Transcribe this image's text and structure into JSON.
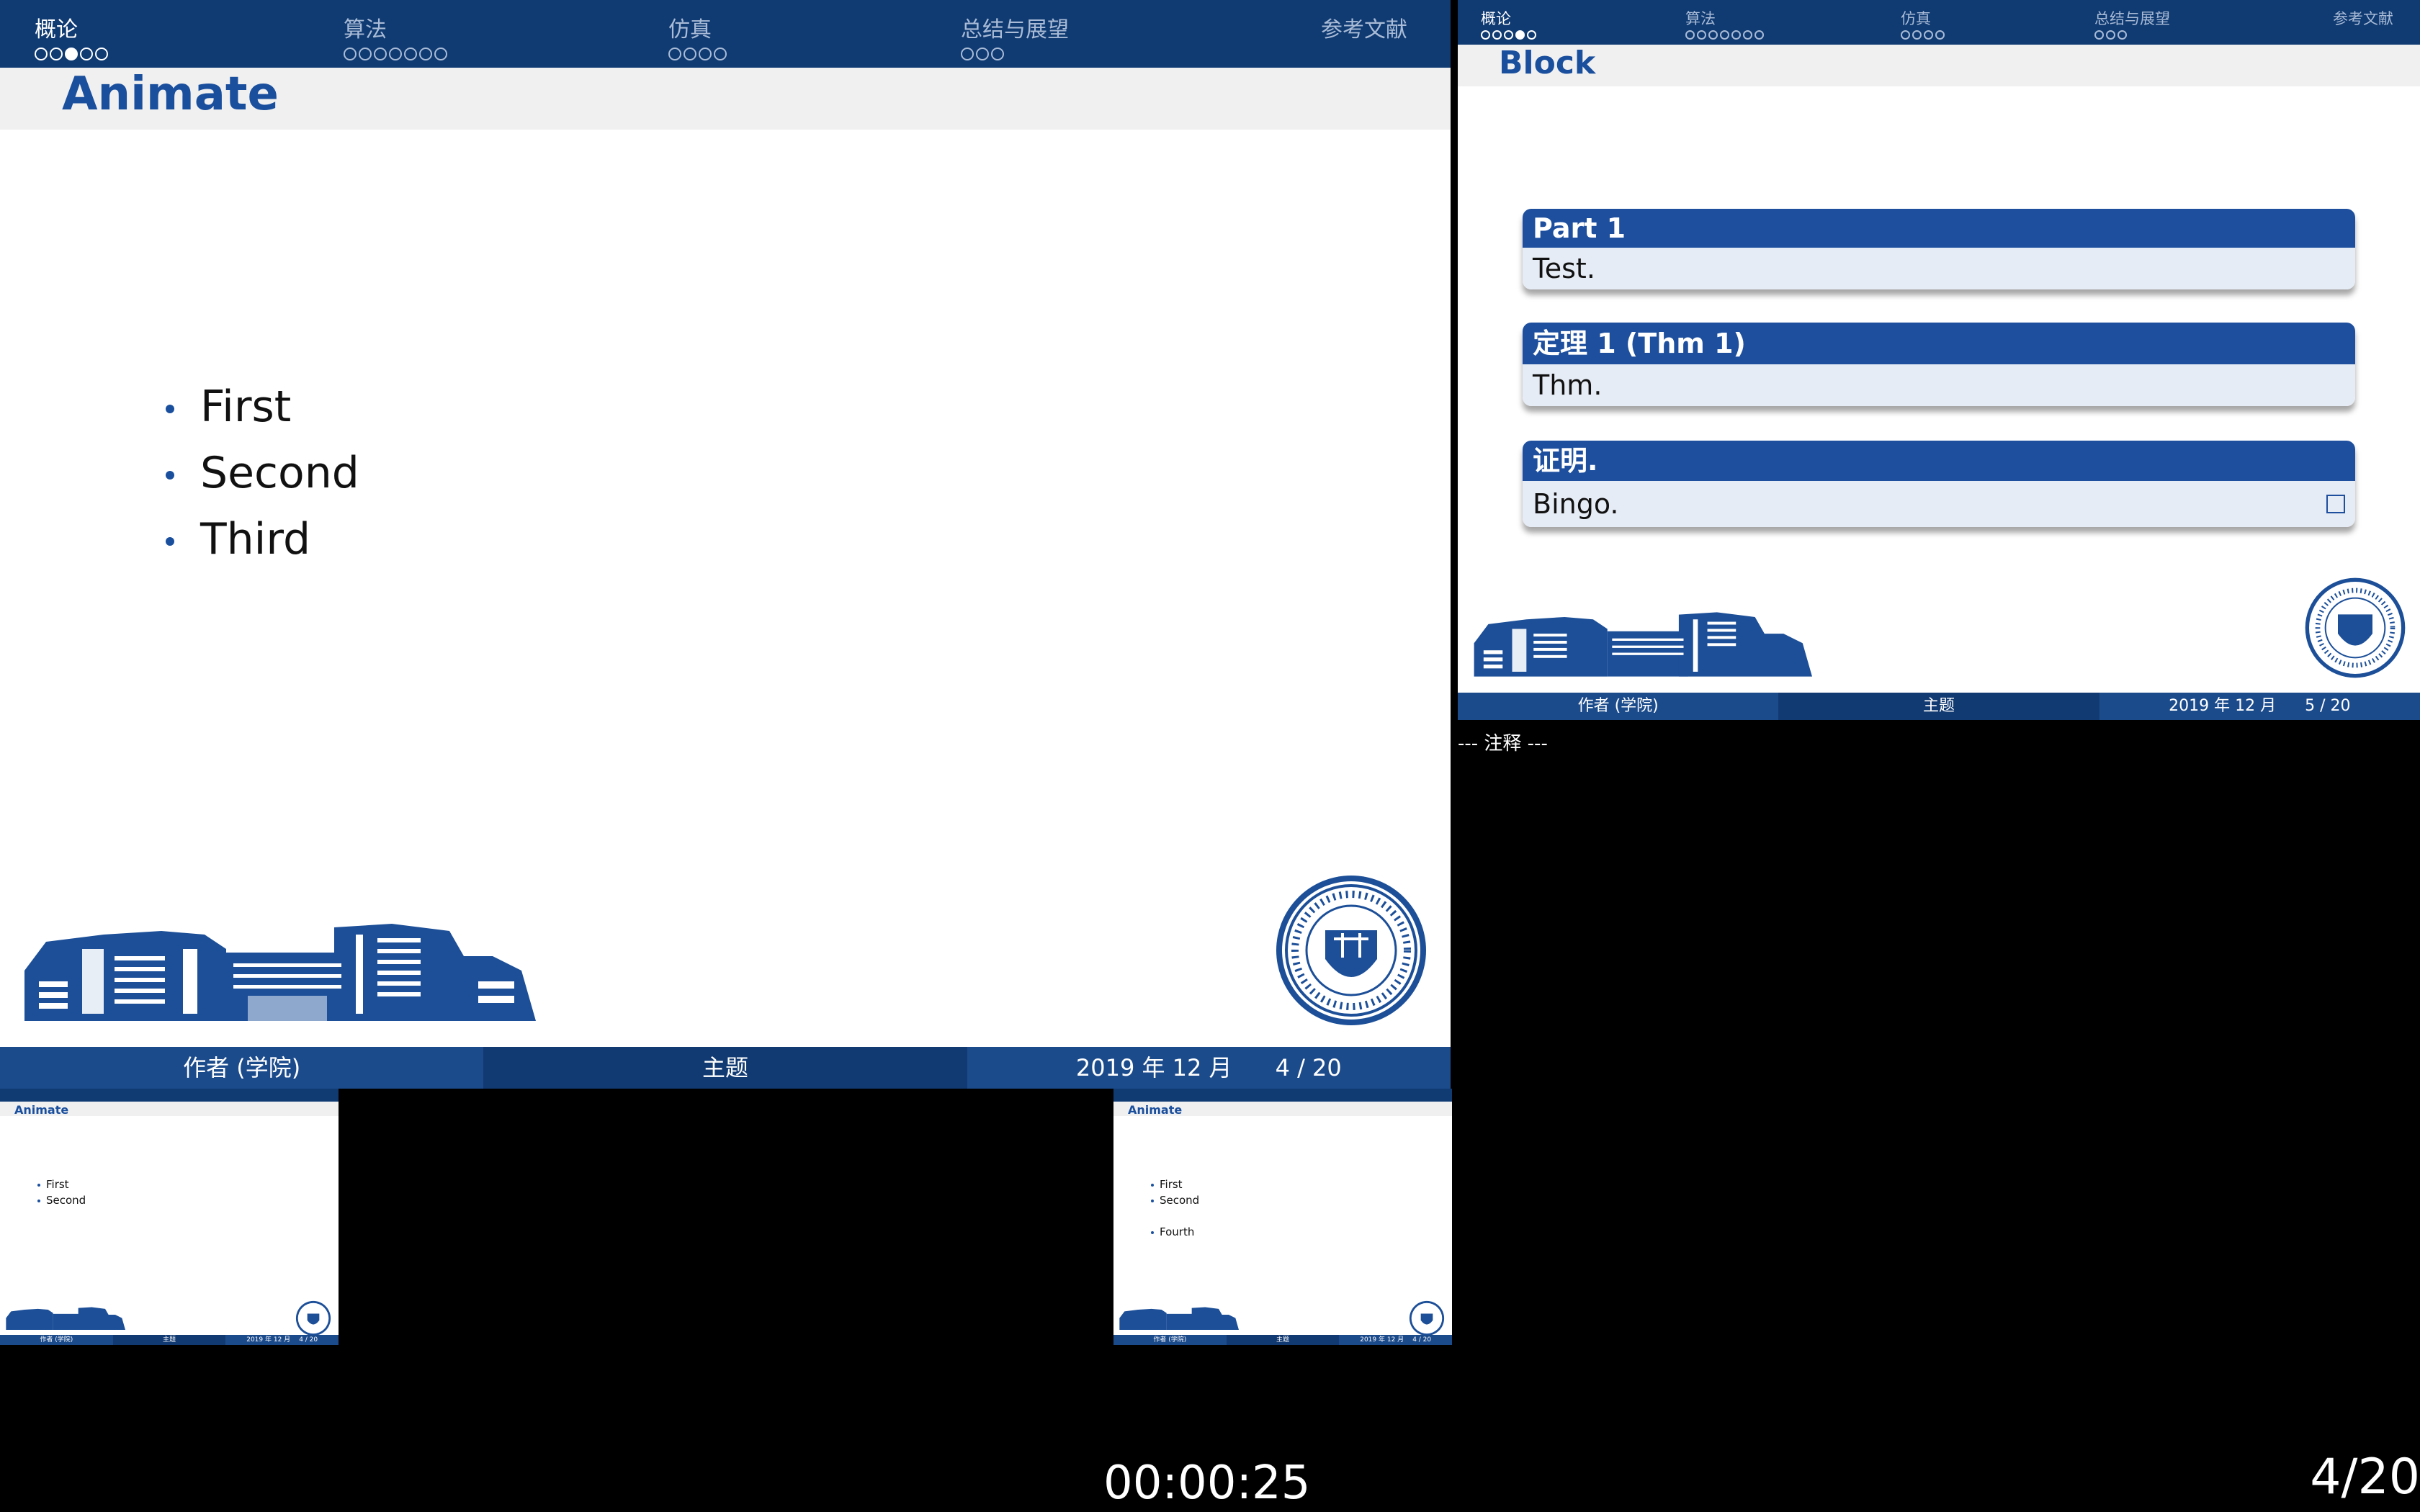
{
  "nav": {
    "sections": [
      {
        "label": "概论",
        "dots": 5,
        "filled": 3,
        "active": true
      },
      {
        "label": "算法",
        "dots": 7,
        "filled": 0,
        "active": false
      },
      {
        "label": "仿真",
        "dots": 4,
        "filled": 0,
        "active": false
      },
      {
        "label": "总结与展望",
        "dots": 3,
        "filled": 0,
        "active": false
      },
      {
        "label": "参考文献",
        "dots": 0,
        "filled": 0,
        "active": false
      }
    ]
  },
  "current_slide": {
    "title": "Animate",
    "bullets": [
      "First",
      "Second",
      "Third"
    ],
    "footer": {
      "author": "作者 (学院)",
      "topic": "主题",
      "date": "2019 年 12 月",
      "page": "4 / 20"
    }
  },
  "next_slide": {
    "nav_filled": 4,
    "title": "Block",
    "blocks": [
      {
        "head": "Part 1",
        "body": "Test.",
        "qed": false
      },
      {
        "head": "定理 1 (Thm 1)",
        "body": "Thm.",
        "qed": false
      },
      {
        "head": "证明.",
        "body": "Bingo.",
        "qed": true
      }
    ],
    "footer": {
      "author": "作者 (学院)",
      "topic": "主题",
      "date": "2019 年 12 月",
      "page": "5 / 20"
    }
  },
  "notes": {
    "text": "--- 注释 ---"
  },
  "prev_thumb": {
    "title": "Animate",
    "bullets": [
      "First",
      "Second"
    ]
  },
  "next_thumb": {
    "title": "Animate",
    "bullets": [
      "First",
      "Second",
      "",
      "Fourth"
    ]
  },
  "thumb_footer": {
    "author": "作者 (学院)",
    "topic": "主题",
    "date": "2019 年 12 月",
    "page": "4 / 20"
  },
  "timer": {
    "elapsed": "00:00:25"
  },
  "counter": {
    "page": "4/20"
  },
  "colors": {
    "navy": "#0f3a72",
    "blue": "#1a4f9e",
    "block_body": "#e6ecf5"
  }
}
